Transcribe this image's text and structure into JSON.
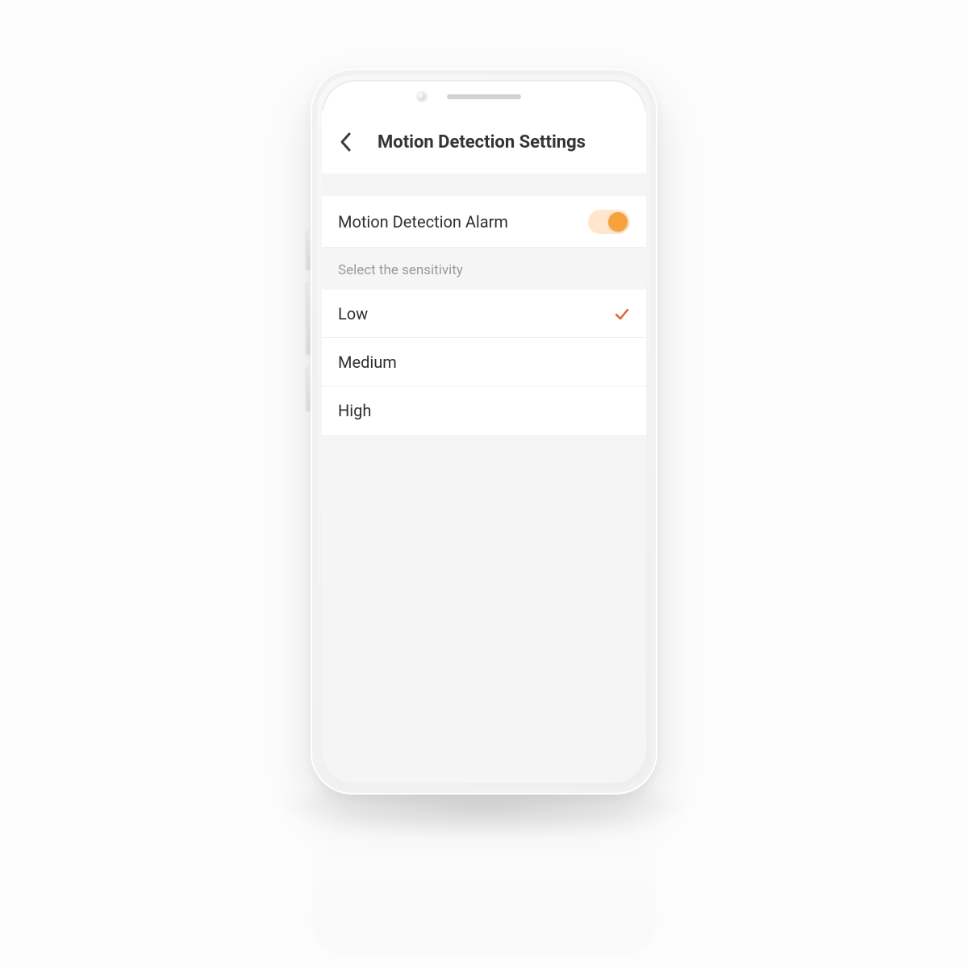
{
  "header": {
    "title": "Motion Detection Settings"
  },
  "alarm": {
    "label": "Motion Detection Alarm",
    "enabled": true
  },
  "sensitivity": {
    "section_label": "Select the sensitivity",
    "options": [
      "Low",
      "Medium",
      "High"
    ],
    "selected": "Low"
  },
  "colors": {
    "accent": "#f7a23b",
    "check": "#e0622b"
  }
}
